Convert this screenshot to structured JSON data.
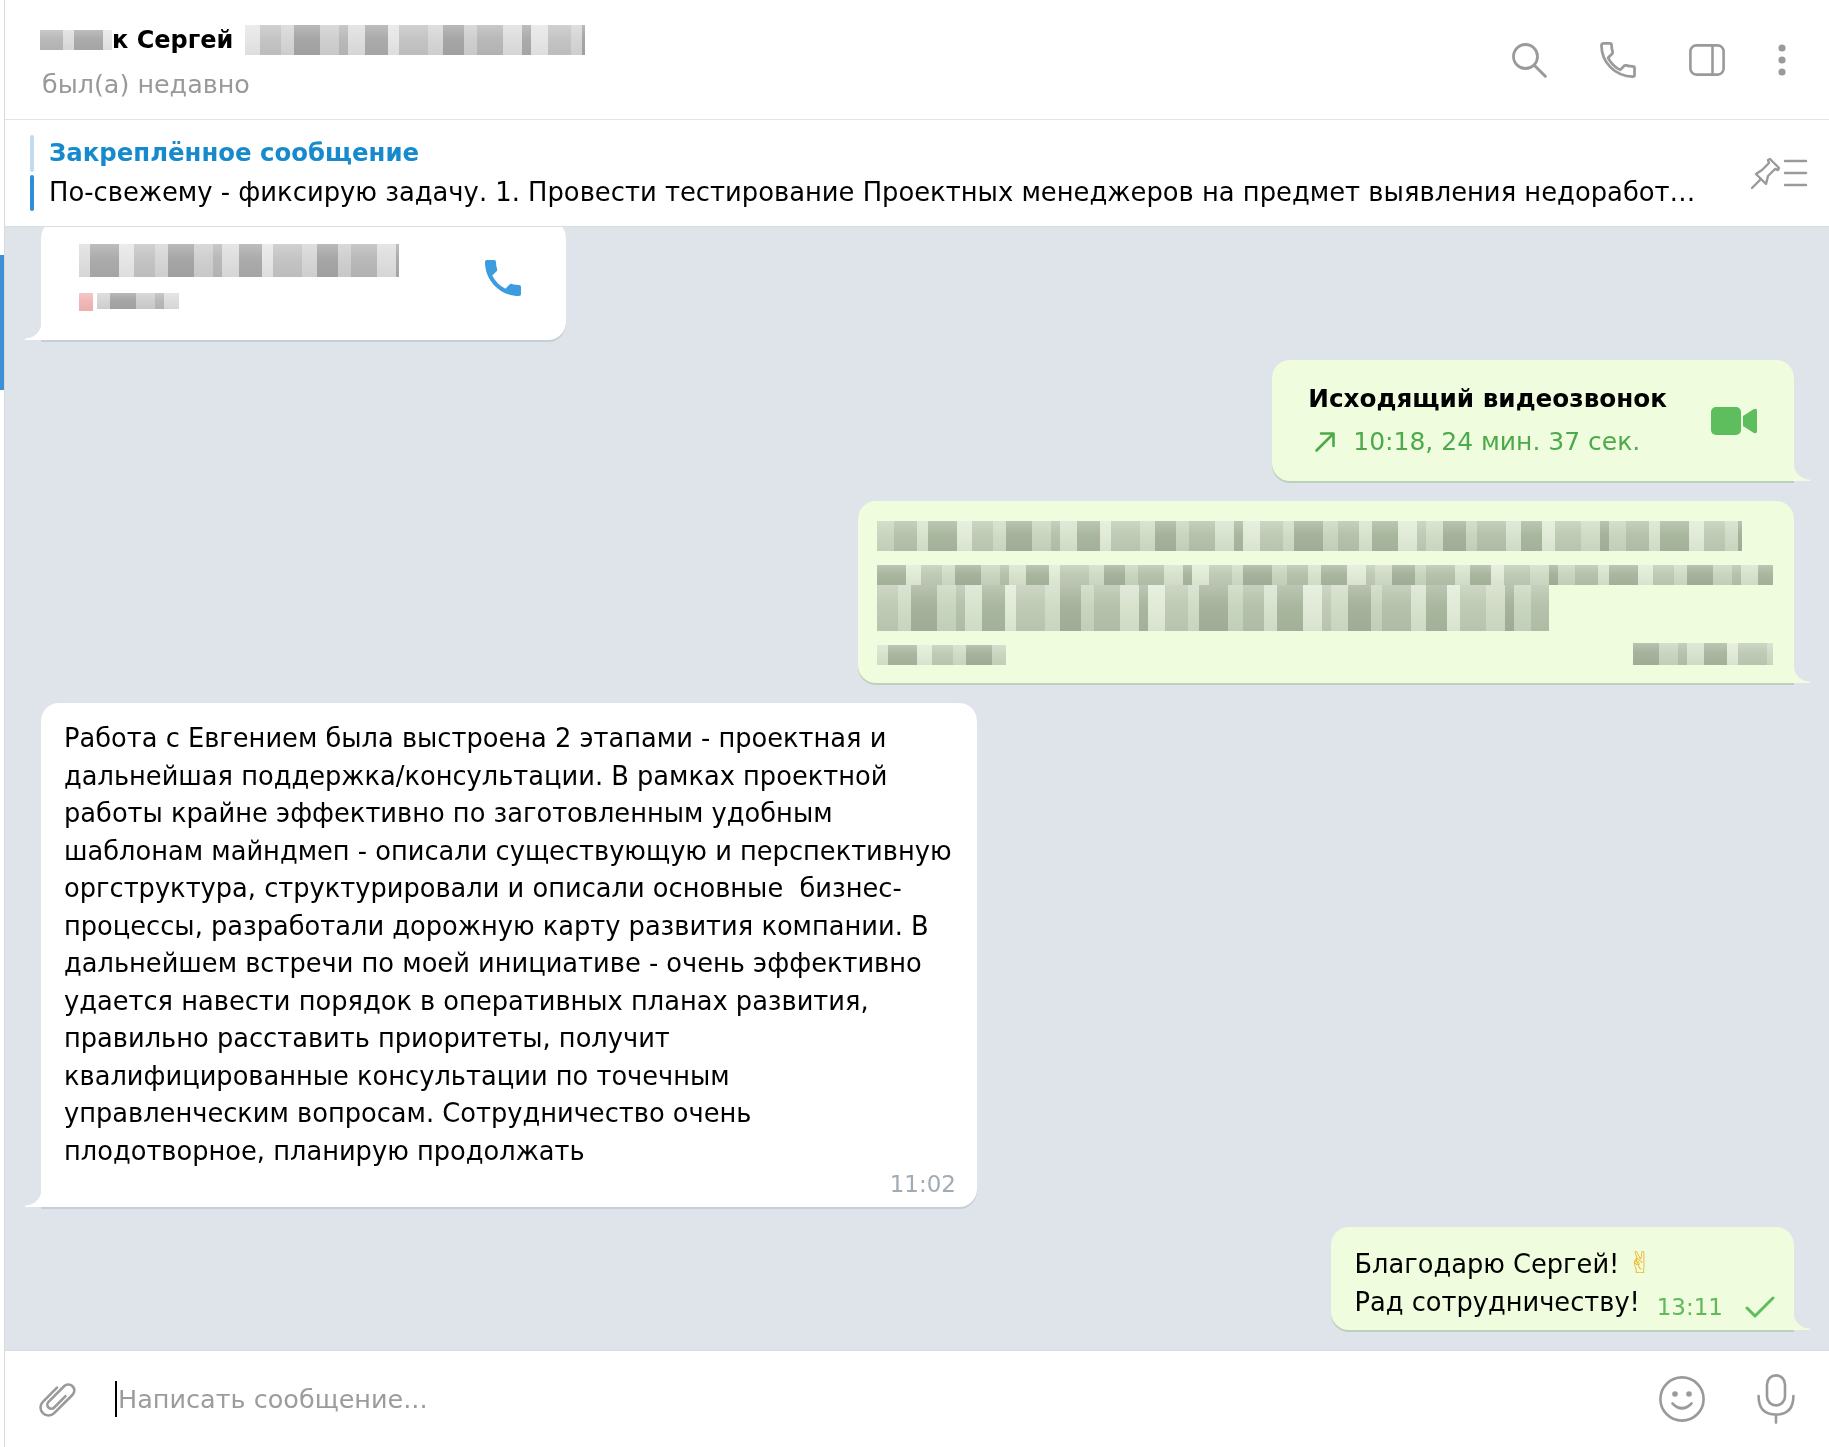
{
  "chat_header": {
    "title": "к Сергей",
    "status": "был(а) недавно",
    "redacted": true
  },
  "pinned_message": {
    "label": "Закреплённое сообщение",
    "text": "По-свежему - фиксирую задачу. 1. Провести тестирование Проектных менеджеров на предмет выявления недоработ…",
    "pins": [
      {
        "selected": false
      },
      {
        "selected": true
      }
    ]
  },
  "messages": [
    {
      "kind": "voice_call",
      "outgoing": false,
      "redacted": true
    },
    {
      "kind": "video_call",
      "outgoing": true,
      "redacted": false,
      "title": "Исходящий видеозвонок",
      "details": "10:18, 24 мин. 37 сек."
    },
    {
      "kind": "text",
      "outgoing": true,
      "redacted": true
    },
    {
      "kind": "text",
      "outgoing": false,
      "redacted": false,
      "lines": [
        "Работа с Евгением была выстроена 2 этапами - проектная и дальнейшая поддержка/консультации. В рамках проектной работы крайне эффективно по заготовленным удобным шаблонам майндмеп - описали существующую и перспективную оргструктура, структурировали и описали основные  бизнес-процессы, разработали дорожную карту развития компании. В дальнейшем встречи по моей инициативе - очень эффективно удается навести порядок в оперативных планах развития, правильно расставить приоритеты, получит квалифицированные консультации по точечным управленческим вопросам. Сотрудничество очень плодотворное, планирую продолжать"
      ],
      "time": "11:02"
    },
    {
      "kind": "text",
      "outgoing": true,
      "redacted": false,
      "lines": [
        "Благодарю Сергей! ✌",
        "Рад сотрудничеству!"
      ],
      "time": "13:11",
      "read": false
    }
  ],
  "composer": {
    "placeholder": "Написать сообщение..."
  }
}
